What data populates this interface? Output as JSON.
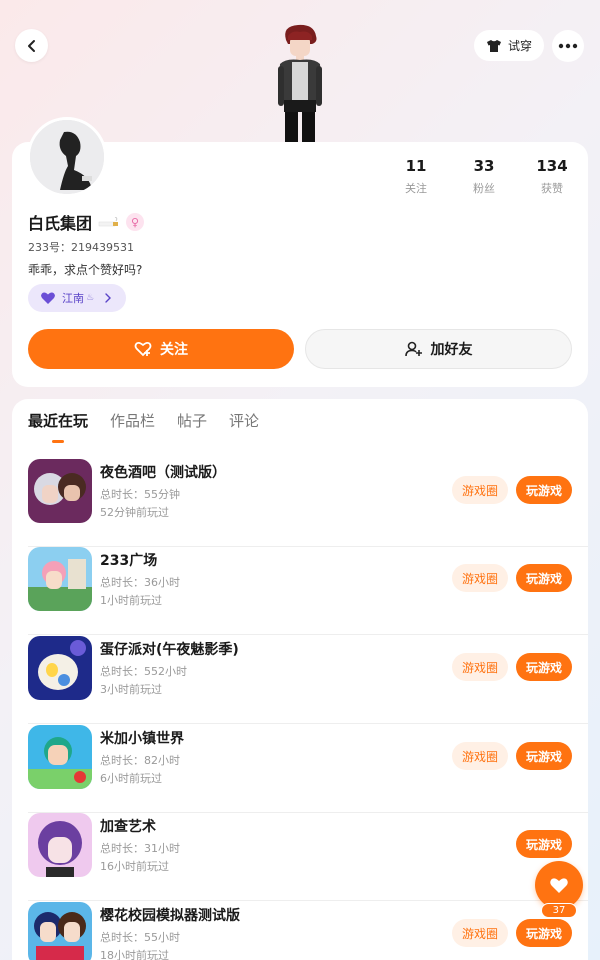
{
  "topbar": {
    "tryon_label": "试穿"
  },
  "profile": {
    "nickname": "白氏集团",
    "account_id": "233号：219439531",
    "bio": "乖乖，求点个赞好吗?",
    "location": "江南",
    "stats": [
      {
        "value": "11",
        "label": "关注"
      },
      {
        "value": "33",
        "label": "粉丝"
      },
      {
        "value": "134",
        "label": "获赞"
      }
    ],
    "follow_label": "关注",
    "add_friend_label": "加好友"
  },
  "tabs": [
    {
      "label": "最近在玩",
      "active": true
    },
    {
      "label": "作品栏",
      "active": false
    },
    {
      "label": "帖子",
      "active": false
    },
    {
      "label": "评论",
      "active": false
    }
  ],
  "games": [
    {
      "title": "夜色酒吧（测试版）",
      "duration": "总时长：55分钟",
      "last_played": "52分钟前玩过",
      "circle_label": "游戏圈",
      "play_label": "玩游戏",
      "has_circle": true
    },
    {
      "title": "233广场",
      "duration": "总时长：36小时",
      "last_played": "1小时前玩过",
      "circle_label": "游戏圈",
      "play_label": "玩游戏",
      "has_circle": true
    },
    {
      "title": "蛋仔派对(午夜魅影季)",
      "duration": "总时长：552小时",
      "last_played": "3小时前玩过",
      "circle_label": "游戏圈",
      "play_label": "玩游戏",
      "has_circle": true
    },
    {
      "title": "米加小镇世界",
      "duration": "总时长：82小时",
      "last_played": "6小时前玩过",
      "circle_label": "游戏圈",
      "play_label": "玩游戏",
      "has_circle": true
    },
    {
      "title": "加查艺术",
      "duration": "总时长：31小时",
      "last_played": "16小时前玩过",
      "circle_label": "",
      "play_label": "玩游戏",
      "has_circle": false
    },
    {
      "title": "樱花校园模拟器测试版",
      "duration": "总时长：55小时",
      "last_played": "18小时前玩过",
      "circle_label": "游戏圈",
      "play_label": "玩游戏",
      "has_circle": true
    }
  ],
  "like_count": "37",
  "colors": {
    "accent": "#ff7311",
    "accent_light": "#fff0e5",
    "location_bg": "#ece7fb",
    "location_fg": "#5a44c8"
  }
}
